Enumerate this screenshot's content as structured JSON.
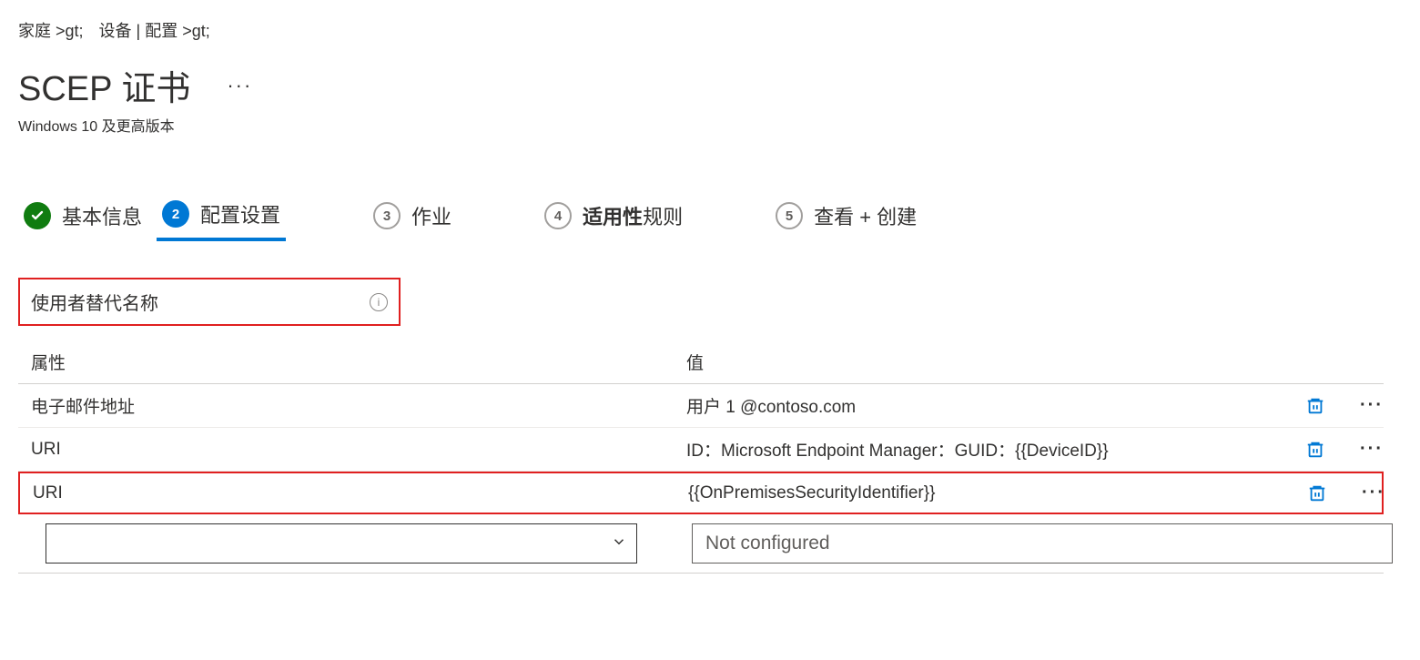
{
  "breadcrumb": {
    "items": [
      "家庭 >gt;",
      "设备 | 配置 >gt;"
    ]
  },
  "header": {
    "title": "SCEP 证书",
    "subtitle": "Windows 10 及更高版本",
    "more": "···"
  },
  "tabs": {
    "t1": "基本信息",
    "t2": "配置设置",
    "n3": "3",
    "t3": "作业",
    "n4": "4",
    "t4_bold": "适用性",
    "t4_rest": "规则",
    "n5": "5",
    "t5": "查看 + 创建"
  },
  "section": {
    "label": "使用者替代名称"
  },
  "table": {
    "col_attr": "属性",
    "col_value": "值",
    "rows": [
      {
        "attr": "电子邮件地址",
        "value": "用户 1 @contoso.com",
        "highlight": false
      },
      {
        "attr": "URI",
        "value": "ID：Microsoft Endpoint Manager：GUID：{{DeviceID}}",
        "highlight": false
      },
      {
        "attr": "URI",
        "value": "{{OnPremisesSecurityIdentifier}}",
        "highlight": true
      }
    ],
    "placeholder_value": "Not configured"
  }
}
